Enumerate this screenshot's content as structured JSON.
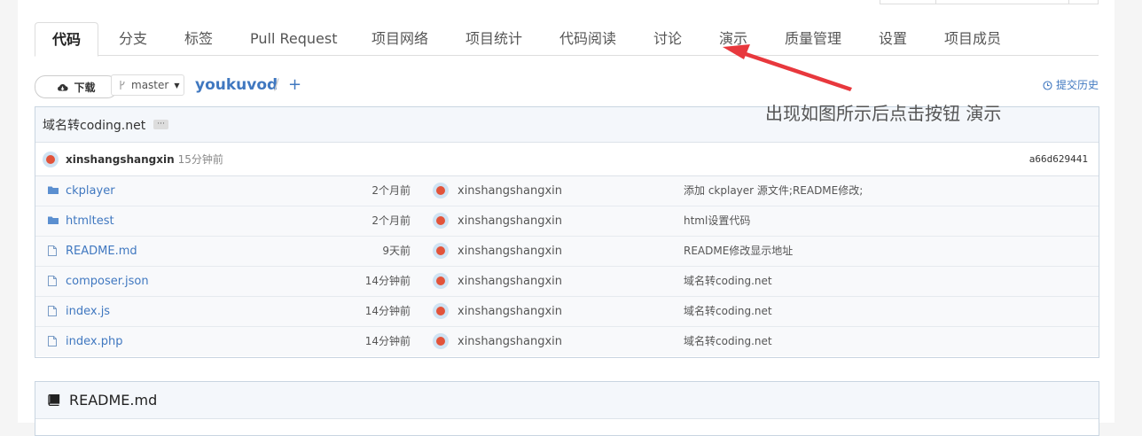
{
  "tabs": [
    {
      "label": "代码",
      "active": true
    },
    {
      "label": "分支"
    },
    {
      "label": "标签"
    },
    {
      "label": "Pull Request"
    },
    {
      "label": "项目网络"
    },
    {
      "label": "项目统计"
    },
    {
      "label": "代码阅读"
    },
    {
      "label": "讨论"
    },
    {
      "label": "演示"
    },
    {
      "label": "质量管理"
    },
    {
      "label": "设置"
    },
    {
      "label": "项目成员"
    }
  ],
  "toolbar": {
    "download_label": "下载",
    "branch": "master",
    "repo": "youkuvod",
    "slash": "/",
    "plus": "+",
    "history_label": "提交历史"
  },
  "annotation": {
    "text": "出现如图所示后点击按钮 演示",
    "color": "#e8383d"
  },
  "commit": {
    "title": "域名转coding.net",
    "more": "···",
    "author": "xinshangshangxin",
    "ago": "15分钟前",
    "sha": "a66d629441"
  },
  "files": [
    {
      "type": "folder",
      "name": "ckplayer",
      "age": "2个月前",
      "user": "xinshangshangxin",
      "message": "添加 ckplayer 源文件;README修改;"
    },
    {
      "type": "folder",
      "name": "htmltest",
      "age": "2个月前",
      "user": "xinshangshangxin",
      "message": "html设置代码"
    },
    {
      "type": "file",
      "name": "README.md",
      "age": "9天前",
      "user": "xinshangshangxin",
      "message": "README修改显示地址"
    },
    {
      "type": "file",
      "name": "composer.json",
      "age": "14分钟前",
      "user": "xinshangshangxin",
      "message": "域名转coding.net"
    },
    {
      "type": "file",
      "name": "index.js",
      "age": "14分钟前",
      "user": "xinshangshangxin",
      "message": "域名转coding.net"
    },
    {
      "type": "file",
      "name": "index.php",
      "age": "14分钟前",
      "user": "xinshangshangxin",
      "message": "域名转coding.net"
    }
  ],
  "readme": {
    "title": "README.md"
  },
  "colors": {
    "link": "#4078c0",
    "folder": "#5b8fd0",
    "avatar_bg": "#cfe3f3",
    "avatar_fg": "#e2533a"
  }
}
